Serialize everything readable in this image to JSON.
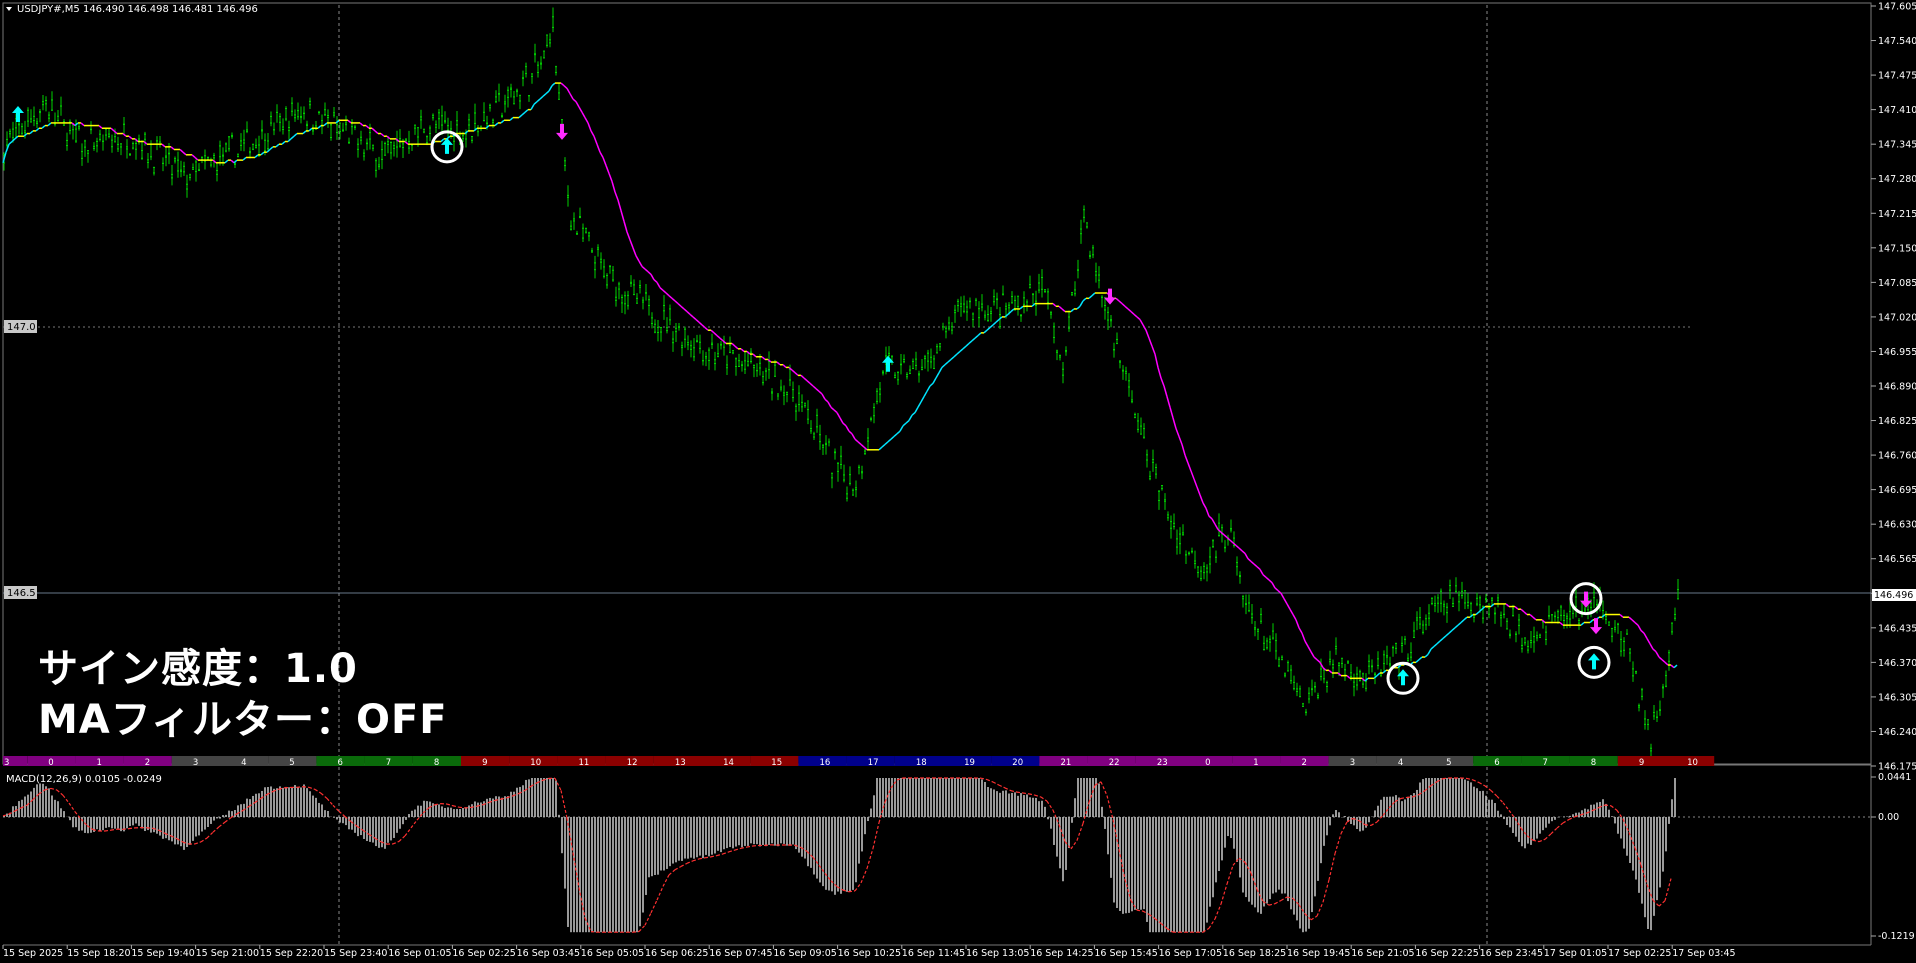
{
  "header": {
    "symbol_line": "USDJPY#,M5  146.490 146.498 146.481 146.496",
    "macd_line": "MACD(12,26,9) 0.0105 -0.0249"
  },
  "overlay": {
    "line1": "サイン感度：1.0",
    "line2": "MAフィルター：OFF"
  },
  "price_axis": {
    "ticks": [
      "147.605",
      "147.540",
      "147.475",
      "147.410",
      "147.345",
      "147.280",
      "147.215",
      "147.150",
      "147.085",
      "147.020",
      "146.955",
      "146.890",
      "146.825",
      "146.760",
      "146.695",
      "146.630",
      "146.565",
      "146.500",
      "146.435",
      "146.370",
      "146.305",
      "146.240",
      "146.175"
    ],
    "current_price": "146.496",
    "level_labels": [
      "147.0",
      "146.5"
    ]
  },
  "macd_axis": {
    "ticks": [
      "0.0441",
      "0.00",
      "-0.1219"
    ]
  },
  "time_axis": {
    "labels": [
      "15 Sep 2025",
      "15 Sep 18:20",
      "15 Sep 19:40",
      "15 Sep 21:00",
      "15 Sep 22:20",
      "15 Sep 23:40",
      "16 Sep 01:05",
      "16 Sep 02:25",
      "16 Sep 03:45",
      "16 Sep 05:05",
      "16 Sep 06:25",
      "16 Sep 07:45",
      "16 Sep 09:05",
      "16 Sep 10:25",
      "16 Sep 11:45",
      "16 Sep 13:05",
      "16 Sep 14:25",
      "16 Sep 15:45",
      "16 Sep 17:05",
      "16 Sep 18:25",
      "16 Sep 19:45",
      "16 Sep 21:05",
      "16 Sep 22:25",
      "16 Sep 23:45",
      "17 Sep 01:05",
      "17 Sep 02:25",
      "17 Sep 03:45"
    ]
  },
  "hour_strip": {
    "hours": [
      "3",
      "0",
      "1",
      "2",
      "3",
      "4",
      "5",
      "6",
      "7",
      "8",
      "9",
      "10",
      "11",
      "12",
      "13",
      "14",
      "15",
      "16",
      "17",
      "18",
      "19",
      "20",
      "21",
      "22",
      "23",
      "0",
      "1",
      "2",
      "3",
      "4",
      "5",
      "6",
      "7",
      "8",
      "9",
      "10"
    ],
    "colors": [
      "#800080",
      "#800080",
      "#800080",
      "#800080",
      "#444444",
      "#444444",
      "#444444",
      "#0a6a0a",
      "#0a6a0a",
      "#0a6a0a",
      "#8b0000",
      "#8b0000",
      "#8b0000",
      "#8b0000",
      "#8b0000",
      "#8b0000",
      "#8b0000",
      "#00008b",
      "#00008b",
      "#00008b",
      "#00008b",
      "#00008b",
      "#800080",
      "#800080",
      "#800080",
      "#800080",
      "#800080",
      "#800080",
      "#444444",
      "#444444",
      "#444444",
      "#0a6a0a",
      "#0a6a0a",
      "#0a6a0a",
      "#8b0000",
      "#8b0000"
    ]
  },
  "colors": {
    "background": "#000000",
    "candle": "#00d000",
    "ma_up": "#ffff00",
    "ma_down": "#ff00ff",
    "ma_cyan": "#00e5ff",
    "buy_arrow": "#00ffff",
    "sell_arrow": "#ff2bff",
    "macd_hist": "#c0c0c0",
    "macd_signal": "#ff3030"
  },
  "chart_data": {
    "type": "line",
    "price_path": [
      [
        0,
        147.34
      ],
      [
        40,
        147.42
      ],
      [
        80,
        147.34
      ],
      [
        130,
        147.36
      ],
      [
        180,
        147.28
      ],
      [
        240,
        147.34
      ],
      [
        300,
        147.41
      ],
      [
        380,
        147.32
      ],
      [
        420,
        147.38
      ],
      [
        460,
        147.37
      ],
      [
        500,
        147.42
      ],
      [
        540,
        147.5
      ],
      [
        548,
        147.58
      ],
      [
        565,
        147.22
      ],
      [
        600,
        147.1
      ],
      [
        640,
        147.04
      ],
      [
        700,
        146.96
      ],
      [
        740,
        146.93
      ],
      [
        790,
        146.88
      ],
      [
        830,
        146.74
      ],
      [
        850,
        146.7
      ],
      [
        880,
        146.92
      ],
      [
        920,
        146.92
      ],
      [
        960,
        147.04
      ],
      [
        1000,
        147.03
      ],
      [
        1040,
        147.07
      ],
      [
        1060,
        146.92
      ],
      [
        1080,
        147.22
      ],
      [
        1090,
        147.12
      ],
      [
        1110,
        146.98
      ],
      [
        1140,
        146.78
      ],
      [
        1170,
        146.62
      ],
      [
        1200,
        146.55
      ],
      [
        1225,
        146.63
      ],
      [
        1240,
        146.48
      ],
      [
        1280,
        146.36
      ],
      [
        1300,
        146.28
      ],
      [
        1330,
        146.38
      ],
      [
        1360,
        146.34
      ],
      [
        1400,
        146.38
      ],
      [
        1420,
        146.45
      ],
      [
        1450,
        146.49
      ],
      [
        1490,
        146.48
      ],
      [
        1520,
        146.42
      ],
      [
        1560,
        146.46
      ],
      [
        1600,
        146.48
      ],
      [
        1630,
        146.36
      ],
      [
        1646,
        146.22
      ],
      [
        1660,
        146.32
      ],
      [
        1675,
        146.5
      ]
    ],
    "signals": [
      {
        "type": "buy",
        "price": 147.4,
        "circled": false
      },
      {
        "type": "buy",
        "price": 147.34,
        "circled": true
      },
      {
        "type": "sell",
        "price": 147.37,
        "circled": false
      },
      {
        "type": "buy",
        "price": 146.93,
        "circled": false
      },
      {
        "type": "sell",
        "price": 147.06,
        "circled": false
      },
      {
        "type": "buy",
        "price": 146.34,
        "circled": true
      },
      {
        "type": "sell",
        "price": 146.49,
        "circled": true
      },
      {
        "type": "sell",
        "price": 146.44,
        "circled": false
      },
      {
        "type": "buy",
        "price": 146.37,
        "circled": true
      }
    ]
  }
}
